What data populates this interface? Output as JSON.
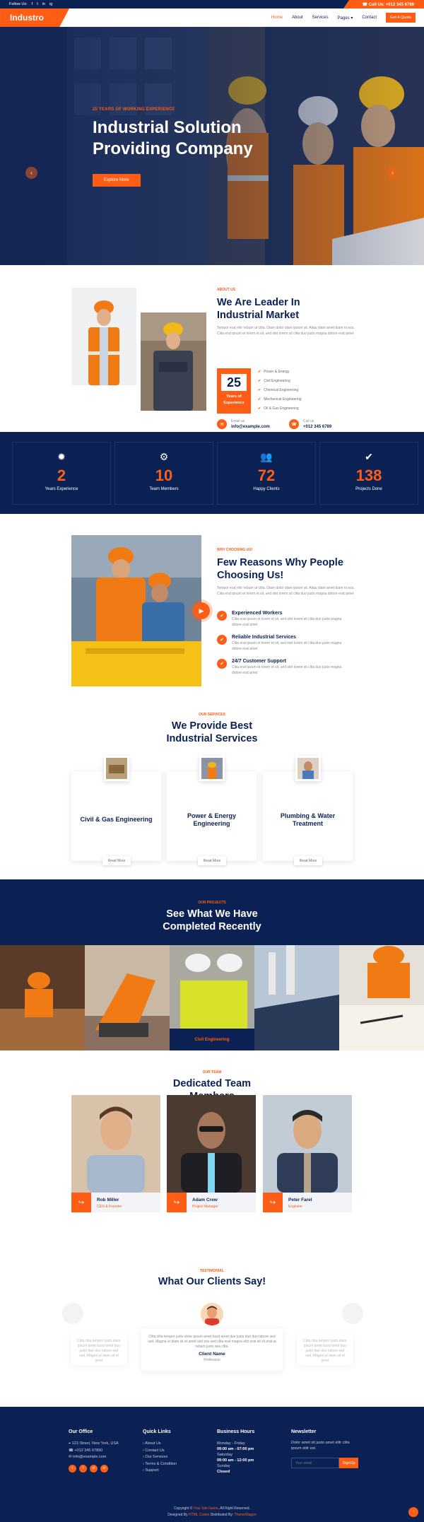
{
  "topbar": {
    "follow_label": "Follow Us:",
    "socials": [
      "f",
      "t",
      "in",
      "ig"
    ],
    "call": "☎ Call Us: +012 345 6789"
  },
  "nav": {
    "logo": "Industro",
    "items": [
      "Home",
      "About",
      "Services",
      "Pages ▾",
      "Contact"
    ],
    "quote": "Get A Quote"
  },
  "hero": {
    "eyebrow": "25 YEARS OF WORKING EXPERIENCE",
    "title_1": "Industrial Solution",
    "title_2": "Providing Company",
    "cta": "Explore More",
    "prev": "‹",
    "next": "›"
  },
  "about": {
    "eyebrow": "ABOUT US",
    "title_1": "We Are Leader In",
    "title_2": "Industrial Market",
    "text": "Tempor erat elitr rebum at clita. Diam dolor diam ipsum sit. Aliqu diam amet diam et eos. Clita erat ipsum et lorem et sit, sed stet lorem sit clita duo justo magna dolore erat amet",
    "years": "25",
    "years_label_1": "Years of",
    "years_label_2": "Experience",
    "checks": [
      "Power & Energy",
      "Civil Engineering",
      "Chemical Engineering",
      "Mechanical Engineering",
      "Oil & Gas Engineering"
    ],
    "email_label": "Email us",
    "email": "info@example.com",
    "call_label": "Call us",
    "phone": "+012 345 6789"
  },
  "stats": [
    {
      "icon": "✹",
      "num": "2",
      "label": "Years Experience"
    },
    {
      "icon": "⚙",
      "num": "10",
      "label": "Team Members"
    },
    {
      "icon": "👥",
      "num": "72",
      "label": "Happy Clients"
    },
    {
      "icon": "✔",
      "num": "138",
      "label": "Projects Done"
    }
  ],
  "why": {
    "eyebrow": "WHY CHOOSING US!",
    "title_1": "Few Reasons Why People",
    "title_2": "Choosing Us!",
    "text": "Tempor erat elitr rebum at clita. Diam dolor diam ipsum sit. Aliqu diam amet diam et eos. Clita erat ipsum et lorem et sit, sed stet lorem sit clita duo justo magna dolore erat amet",
    "features": [
      {
        "title": "Experienced Workers",
        "text": "Clita erat ipsum et lorem et sit, sed stet lorem sit clita duo justo magna dolore erat amet"
      },
      {
        "title": "Reliable Industrial Services",
        "text": "Clita erat ipsum et lorem et sit, sed stet lorem sit clita duo justo magna dolore erat amet"
      },
      {
        "title": "24/7 Customer Support",
        "text": "Clita erat ipsum et lorem et sit, sed stet lorem sit clita duo justo magna dolore erat amet"
      }
    ]
  },
  "services": {
    "eyebrow": "OUR SERVICES",
    "title_1": "We Provide Best",
    "title_2": "Industrial Services",
    "cards": [
      {
        "title_1": "Civil & Gas Engineering",
        "title_2": "",
        "more": "Read More"
      },
      {
        "title_1": "Power & Energy",
        "title_2": "Engineering",
        "more": "Read More"
      },
      {
        "title_1": "Plumbing & Water",
        "title_2": "Treatment",
        "more": "Read More"
      }
    ]
  },
  "projects": {
    "eyebrow": "OUR PROJECTS",
    "title_1": "See What We Have",
    "title_2": "Completed Recently",
    "caption": "Civil Engineering"
  },
  "team": {
    "eyebrow": "OUR TEAM",
    "title_1": "Dedicated Team",
    "title_2": "Members",
    "members": [
      {
        "name": "Rob Miller",
        "role": "CEO & Founder"
      },
      {
        "name": "Adam Crew",
        "role": "Project Manager"
      },
      {
        "name": "Peter Farel",
        "role": "Engineer"
      }
    ]
  },
  "testimonial": {
    "eyebrow": "TESTIMONIAL",
    "title": "What Our Clients Say!",
    "quote": "Clita clita tempor justo dolor ipsum amet kasd amet duo justo duo duo labore sed sed. Magna ut diam sit et amet stet eos sed clita erat magna elitr erat sit sit erat at rebum justo sea clita.",
    "side_quote": "Clita clita tempor justo dolor ipsum amet kasd amet duo justo duo duo labore sed sed. Magna ut diam sit et amet",
    "name": "Client Name",
    "profession": "Profession"
  },
  "footer": {
    "office_title": "Our Office",
    "office": [
      "⌖ 123 Street, New York, USA",
      "☎ +012 345 67890",
      "✉ info@example.com"
    ],
    "socials": [
      "t",
      "f",
      "yt",
      "in"
    ],
    "links_title": "Quick Links",
    "links": [
      "› About Us",
      "› Contact Us",
      "› Our Services",
      "› Terms & Condition",
      "› Support"
    ],
    "hours_title": "Business Hours",
    "hours": [
      {
        "day": "Monday - Friday",
        "time": "09:00 am - 07:00 pm"
      },
      {
        "day": "Saturday",
        "time": "09:00 am - 12:00 pm"
      },
      {
        "day": "Sunday",
        "time": "Closed"
      }
    ],
    "news_title": "Newsletter",
    "news_text": "Dolor amet sit justo amet elitr clita ipsum elitr est.",
    "news_placeholder": "Your email",
    "news_button": "SignUp",
    "copy_1a": "Copyright ©",
    "copy_1b": "Your Site Name",
    "copy_1c": ", All Right Reserved.",
    "copy_2a": "Designed By",
    "copy_2b": "HTML Codex",
    "copy_2c": "Distributed By:",
    "copy_2d": "ThemeWagon",
    "totop": "↑"
  },
  "colors": {
    "navy": "#0b2154",
    "accent": "#fd5d14"
  }
}
